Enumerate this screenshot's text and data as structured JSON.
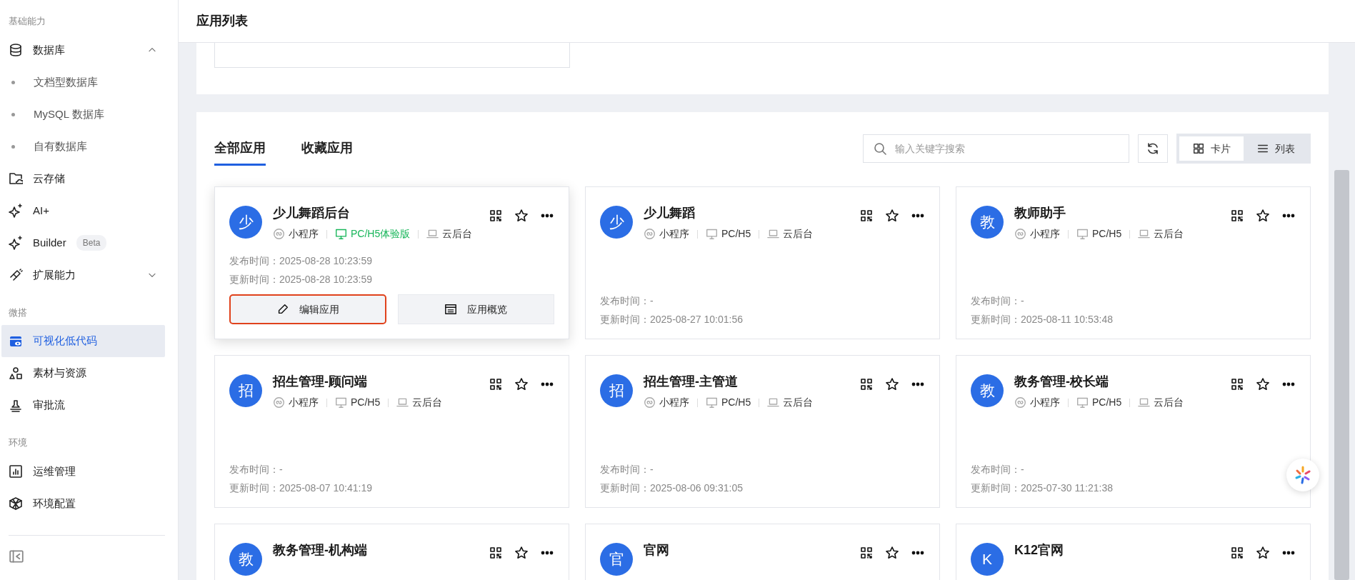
{
  "sidebar": {
    "sections": [
      {
        "title": "基础能力",
        "items": [
          {
            "kind": "database",
            "label": "数据库",
            "expanded": true,
            "selected": false,
            "children": [
              {
                "label": "文档型数据库"
              },
              {
                "label": "MySQL 数据库"
              },
              {
                "label": "自有数据库"
              }
            ]
          },
          {
            "kind": "folder-cloud",
            "label": "云存储",
            "selected": false
          },
          {
            "kind": "sparkle",
            "label": "AI+",
            "selected": false
          },
          {
            "kind": "sparkle",
            "label": "Builder",
            "badge": "Beta",
            "selected": false
          },
          {
            "kind": "plug",
            "label": "扩展能力",
            "expanded": false,
            "selected": false
          }
        ]
      },
      {
        "title": "微搭",
        "items": [
          {
            "kind": "visual",
            "label": "可视化低代码",
            "selected": true
          },
          {
            "kind": "shapes",
            "label": "素材与资源",
            "selected": false
          },
          {
            "kind": "stamp",
            "label": "审批流",
            "selected": false
          }
        ]
      },
      {
        "title": "环境",
        "items": [
          {
            "kind": "chart",
            "label": "运维管理",
            "selected": false
          },
          {
            "kind": "cube",
            "label": "环境配置",
            "selected": false
          }
        ]
      }
    ]
  },
  "header": {
    "title": "应用列表"
  },
  "tabs": [
    {
      "label": "全部应用",
      "selected": true
    },
    {
      "label": "收藏应用",
      "selected": false
    }
  ],
  "search": {
    "placeholder": "输入关键字搜索"
  },
  "view_toggle": [
    {
      "kind": "card",
      "label": "卡片",
      "selected": true
    },
    {
      "kind": "list",
      "label": "列表",
      "selected": false
    }
  ],
  "apps": [
    {
      "avatar": "少",
      "name": "少儿舞蹈后台",
      "hovered": true,
      "platforms": [
        {
          "kind": "mini",
          "label": "小程序",
          "trial": false
        },
        {
          "kind": "pc",
          "label": "PC/H5体验版",
          "trial": true
        },
        {
          "kind": "cloud",
          "label": "云后台",
          "trial": false
        }
      ],
      "published": "发布时间：2025-08-28 10:23:59",
      "updated": "更新时间：2025-08-28 10:23:59",
      "actions": [
        {
          "kind": "edit",
          "label": "编辑应用",
          "highlighted": true
        },
        {
          "kind": "overview",
          "label": "应用概览",
          "highlighted": false
        }
      ]
    },
    {
      "avatar": "少",
      "name": "少儿舞蹈",
      "hovered": false,
      "platforms": [
        {
          "kind": "mini",
          "label": "小程序",
          "trial": false
        },
        {
          "kind": "pc",
          "label": "PC/H5",
          "trial": false
        },
        {
          "kind": "cloud",
          "label": "云后台",
          "trial": false
        }
      ],
      "published": "发布时间：-",
      "updated": "更新时间：2025-08-27 10:01:56"
    },
    {
      "avatar": "教",
      "name": "教师助手",
      "hovered": false,
      "platforms": [
        {
          "kind": "mini",
          "label": "小程序",
          "trial": false
        },
        {
          "kind": "pc",
          "label": "PC/H5",
          "trial": false
        },
        {
          "kind": "cloud",
          "label": "云后台",
          "trial": false
        }
      ],
      "published": "发布时间：-",
      "updated": "更新时间：2025-08-11 10:53:48"
    },
    {
      "avatar": "招",
      "name": "招生管理-顾问端",
      "hovered": false,
      "platforms": [
        {
          "kind": "mini",
          "label": "小程序",
          "trial": false
        },
        {
          "kind": "pc",
          "label": "PC/H5",
          "trial": false
        },
        {
          "kind": "cloud",
          "label": "云后台",
          "trial": false
        }
      ],
      "published": "发布时间：-",
      "updated": "更新时间：2025-08-07 10:41:19"
    },
    {
      "avatar": "招",
      "name": "招生管理-主管道",
      "hovered": false,
      "platforms": [
        {
          "kind": "mini",
          "label": "小程序",
          "trial": false
        },
        {
          "kind": "pc",
          "label": "PC/H5",
          "trial": false
        },
        {
          "kind": "cloud",
          "label": "云后台",
          "trial": false
        }
      ],
      "published": "发布时间：-",
      "updated": "更新时间：2025-08-06 09:31:05"
    },
    {
      "avatar": "教",
      "name": "教务管理-校长端",
      "hovered": false,
      "platforms": [
        {
          "kind": "mini",
          "label": "小程序",
          "trial": false
        },
        {
          "kind": "pc",
          "label": "PC/H5",
          "trial": false
        },
        {
          "kind": "cloud",
          "label": "云后台",
          "trial": false
        }
      ],
      "published": "发布时间：-",
      "updated": "更新时间：2025-07-30 11:21:38"
    },
    {
      "avatar": "教",
      "name": "教务管理-机构端",
      "hovered": false
    },
    {
      "avatar": "官",
      "name": "官网",
      "hovered": false
    },
    {
      "avatar": "K",
      "name": "K12官网",
      "hovered": false
    }
  ]
}
